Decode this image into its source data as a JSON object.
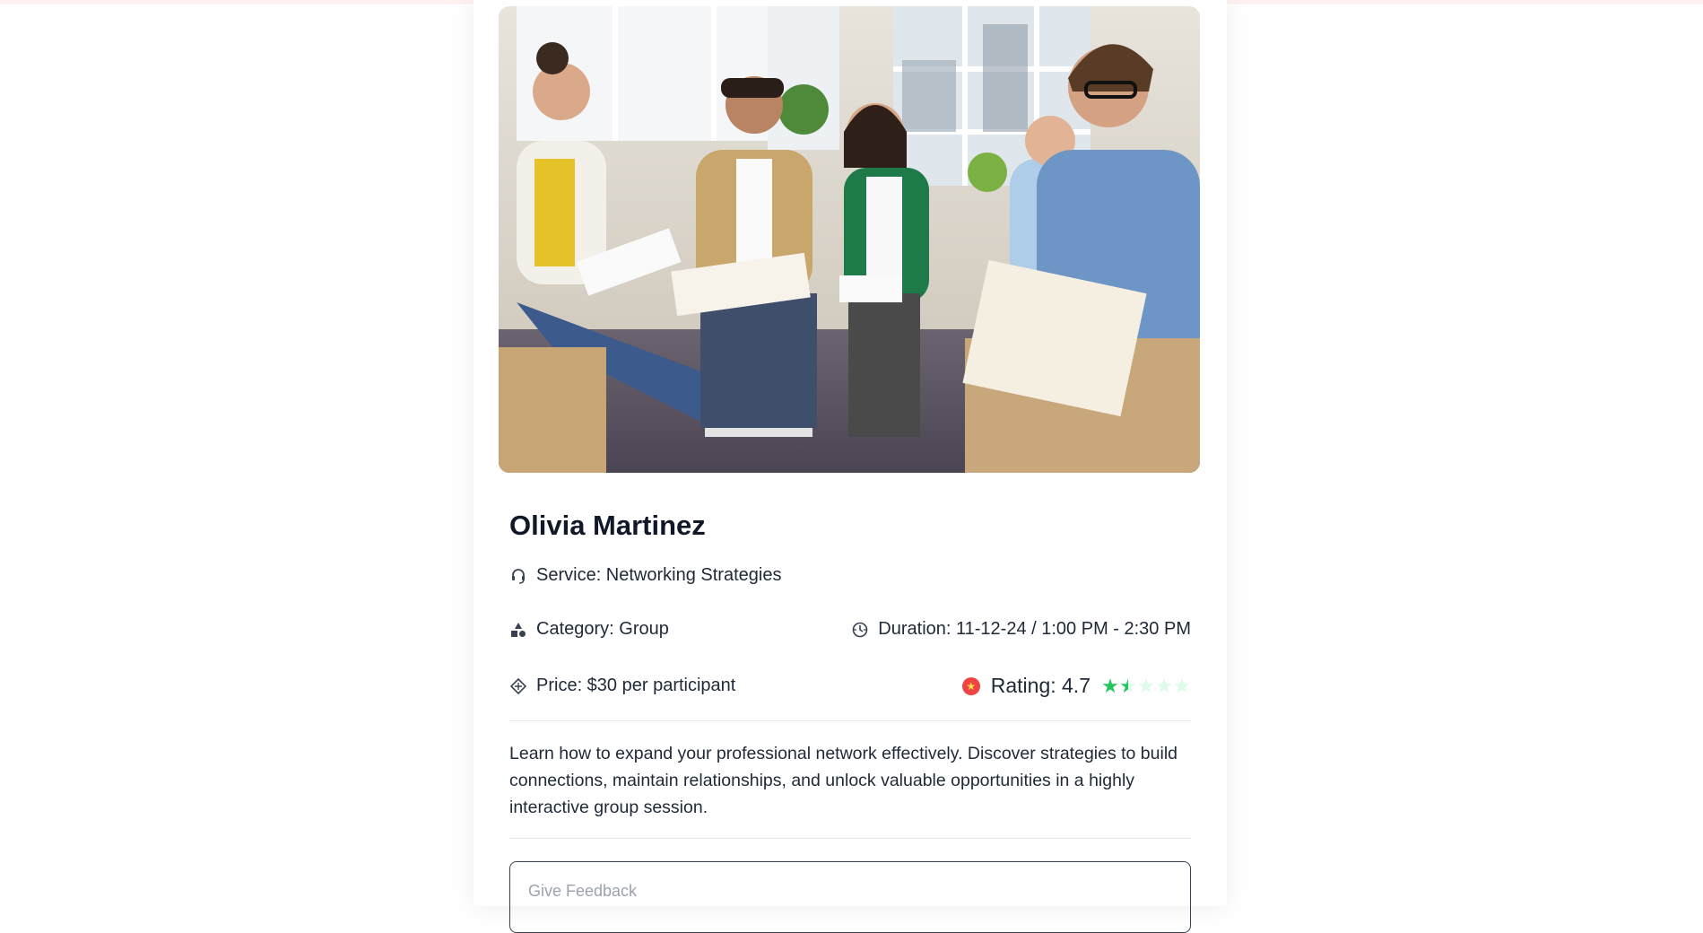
{
  "provider": {
    "name": "Olivia Martinez",
    "service": "Service: Networking Strategies",
    "category": "Category: Group",
    "duration": "Duration: 11-12-24 / 1:00 PM - 2:30 PM",
    "price": "Price: $30 per participant",
    "rating_text": "Rating: 4.7",
    "rating_stars": 1.5,
    "rating_max": 5,
    "description": "Learn how to expand your professional network effectively. Discover strategies to build connections, maintain relationships, and unlock valuable opportunities in a highly interactive group session."
  },
  "feedback": {
    "placeholder": "Give Feedback"
  },
  "icons": {
    "service": "headset-icon",
    "category": "shapes-icon",
    "duration": "globe-clock-icon",
    "price": "price-tag-icon",
    "rating": "star-badge-icon"
  },
  "colors": {
    "star_filled": "#22c55e",
    "star_empty": "#dcfce7",
    "rating_badge": "#ef4444",
    "top_strip": "#fdf2f0"
  }
}
